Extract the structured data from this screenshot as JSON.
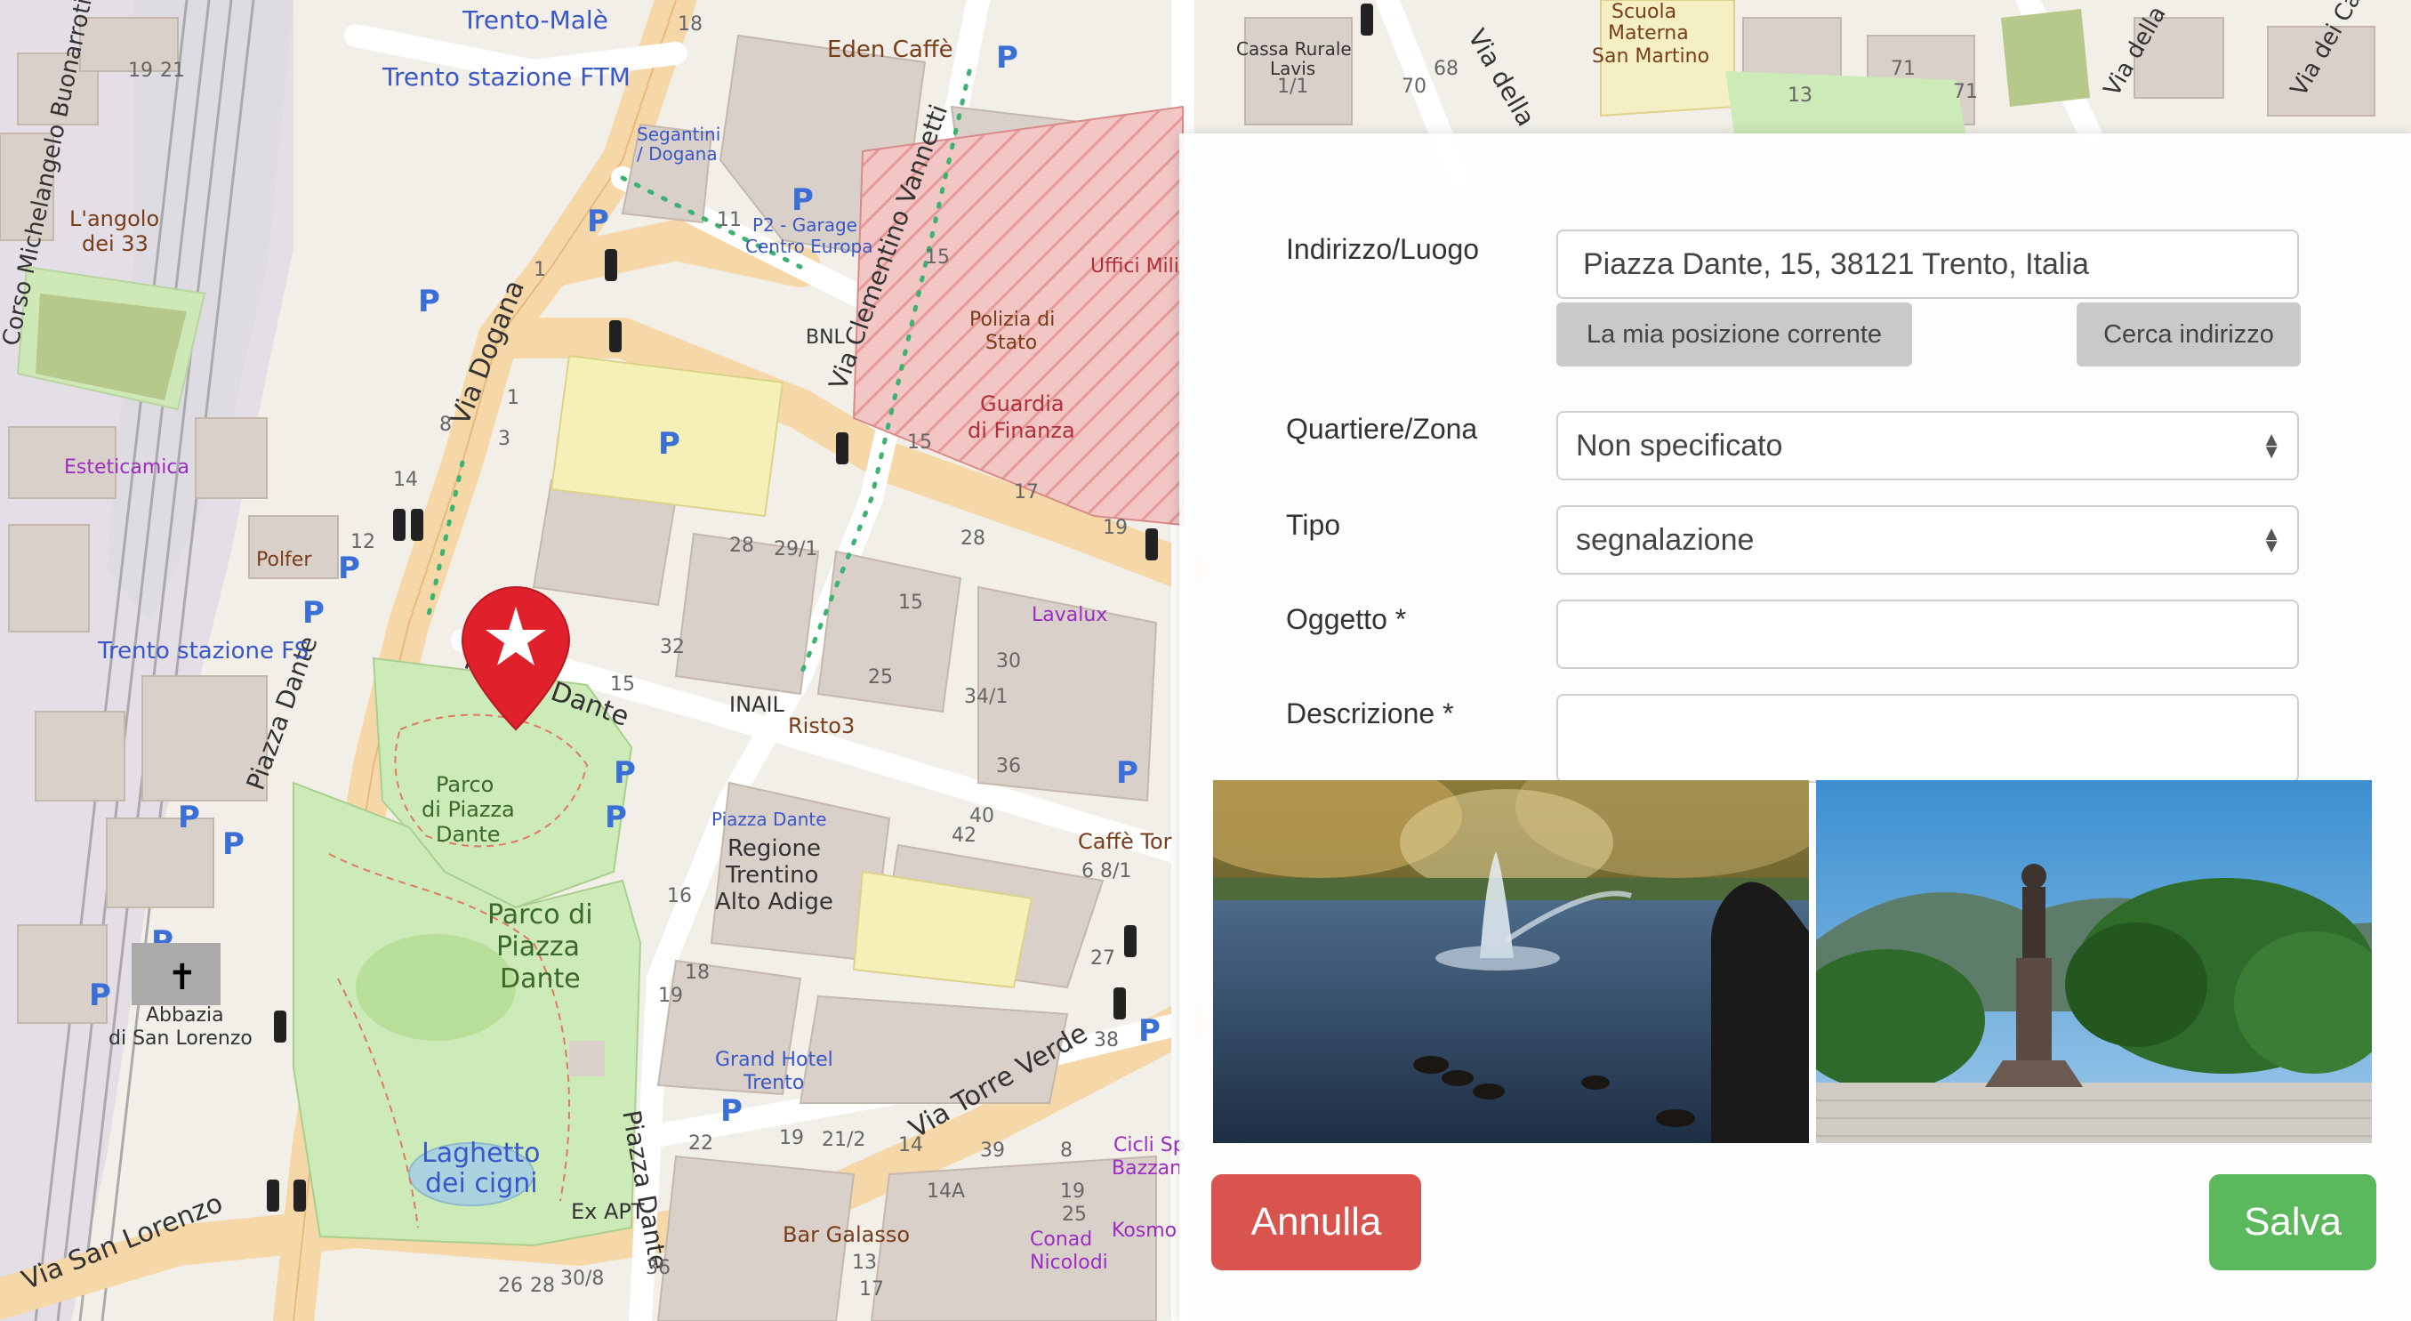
{
  "map": {
    "streets": [
      "Via Dogana",
      "Piazza Dante",
      "Via Clementino Vannetti",
      "Via Torre Verde",
      "Via San Lorenzo",
      "Corso Michelangelo Buonarroti",
      "Via della Prepositura",
      "Via dei Cappuccini",
      "Via della"
    ],
    "places": {
      "trento_male": "Trento-Malè",
      "trento_ftm": "Trento stazione FTM",
      "trento_fs": "Trento stazione FS",
      "eden_caffe": "Eden Caffè",
      "angolo1": "L'angolo",
      "angolo2": "dei 33",
      "esteticamica": "Esteticamica",
      "polfer": "Polfer",
      "segantini1": "Segantini",
      "segantini2": "/ Dogana",
      "p2_1": "P2 - Garage",
      "p2_2": "Centro Europa",
      "bnl": "BNL",
      "polizia1": "Polizia di",
      "polizia2": "Stato",
      "guardia1": "Guardia",
      "guardia2": "di Finanza",
      "uffici": "Uffici Mili",
      "cassa1": "Cassa Rurale",
      "cassa2": "Lavis",
      "scuola1": "Scuola",
      "scuola2": "Materna",
      "scuola3": "San Martino",
      "parco_small1": "Parco",
      "parco_small2": "di Piazza",
      "parco_small3": "Dante",
      "parco_big1": "Parco di",
      "parco_big2": "Piazza",
      "parco_big3": "Dante",
      "laghetto1": "Laghetto",
      "laghetto2": "dei cigni",
      "abbazia1": "Abbazia",
      "abbazia2": "di San Lorenzo",
      "regione1": "Regione",
      "regione2": "Trentino",
      "regione3": "Alto Adige",
      "piazza_dante_stop": "Piazza Dante",
      "inail": "INAIL",
      "risto3": "Risto3",
      "lavalux": "Lavalux",
      "caffe_tor": "Caffè Tor",
      "grand1": "Grand Hotel",
      "grand2": "Trento",
      "ex_apt": "Ex APT",
      "bar_galasso": "Bar Galasso",
      "conad1": "Conad",
      "conad2": "Nicolodi",
      "kosmo": "Kosmo",
      "cicli1": "Cicli Sp",
      "cicli2": "Bazzan"
    }
  },
  "form": {
    "address_label": "Indirizzo/Luogo",
    "address_value": "Piazza Dante, 15, 38121 Trento, Italia",
    "current_position_button": "La mia posizione corrente",
    "search_address_button": "Cerca indirizzo",
    "district_label": "Quartiere/Zona",
    "district_value": "Non specificato",
    "type_label": "Tipo",
    "type_value": "segnalazione",
    "subject_label": "Oggetto *",
    "subject_value": "",
    "description_label": "Descrizione *",
    "description_value": ""
  },
  "actions": {
    "cancel_label": "Annulla",
    "save_label": "Salva"
  },
  "colors": {
    "danger": "#d9534f",
    "success": "#5cb85c",
    "marker": "#e0202a"
  }
}
